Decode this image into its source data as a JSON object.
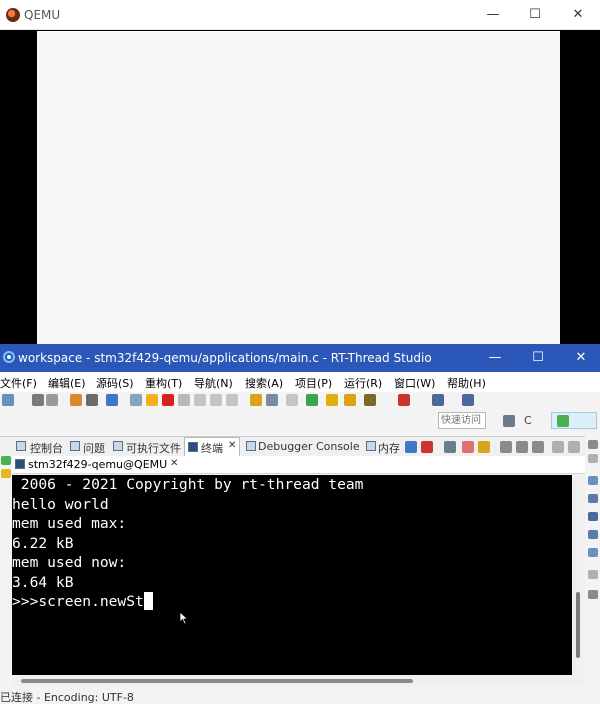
{
  "qemu": {
    "title": "QEMU",
    "controls": {
      "minimize": "—",
      "maximize": "☐",
      "close": "✕"
    }
  },
  "studio": {
    "title": "workspace - stm32f429-qemu/applications/main.c - RT-Thread Studio",
    "controls": {
      "minimize": "—",
      "maximize": "☐",
      "close": "✕"
    },
    "menu": [
      "文件(F)",
      "编辑(E)",
      "源码(S)",
      "重构(T)",
      "导航(N)",
      "搜索(A)",
      "项目(P)",
      "运行(R)",
      "窗口(W)",
      "帮助(H)"
    ],
    "quick_access_placeholder": "快速访问",
    "perspective_label": "C",
    "view_tabs": [
      "控制台",
      "问题",
      "可执行文件",
      "终端",
      "Debugger Console",
      "内存"
    ],
    "active_view_tab": "终端",
    "terminal_tab": "stm32f429-qemu@QEMU",
    "terminal_lines": [
      " 2006 - 2021 Copyright by rt-thread team",
      "hello world",
      "mem used max:",
      "6.22 kB",
      "mem used now:",
      "3.64 kB",
      ">>>screen.newSt"
    ],
    "status": "已连接 - Encoding: UTF-8"
  },
  "colors": {
    "studio_title_bg": "#2b58b8",
    "terminal_bg": "#000000",
    "terminal_fg": "#ffffff"
  }
}
